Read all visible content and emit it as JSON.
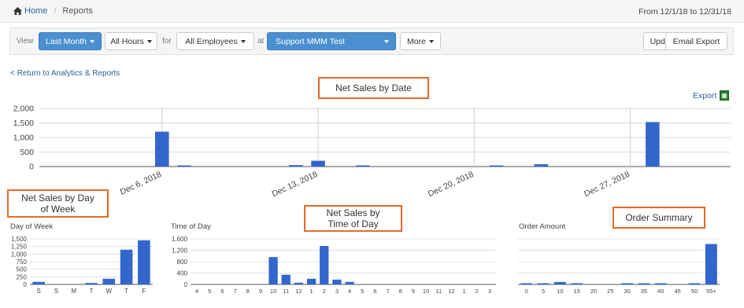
{
  "breadcrumb": {
    "home": "Home",
    "current": "Reports"
  },
  "date_range": "From 12/1/18 to 12/31/18",
  "toolbar": {
    "view_label": "View",
    "period": "Last Month",
    "hours": "All Hours",
    "for_label": "for",
    "employees": "All Employees",
    "at_label": "at",
    "location": "Support MMM Test",
    "more": "More",
    "update": "Update",
    "email_export": "Email Export"
  },
  "links": {
    "return": "< Return to Analytics & Reports",
    "export": "Export"
  },
  "callouts": {
    "net_sales_by_date": "Net Sales by Date",
    "net_sales_by_dow": "Net Sales by Day of Week",
    "net_sales_by_tod": "Net Sales by Time of Day",
    "order_summary": "Order Summary"
  },
  "section_labels": {
    "dow": "Day of Week",
    "tod": "Time of Day",
    "order": "Order Amount"
  },
  "colors": {
    "bar": "#3366cc",
    "accent": "#4a90d0",
    "callout_border": "#e8682a",
    "link": "#2a6496"
  },
  "chart_data": [
    {
      "type": "bar",
      "title": "",
      "x": [
        "12/1",
        "12/2",
        "12/3",
        "12/4",
        "12/5",
        "12/6",
        "12/7",
        "12/8",
        "12/9",
        "12/10",
        "12/11",
        "12/12",
        "12/13",
        "12/14",
        "12/15",
        "12/16",
        "12/17",
        "12/18",
        "12/19",
        "12/20",
        "12/21",
        "12/22",
        "12/23",
        "12/24",
        "12/25",
        "12/26",
        "12/27",
        "12/28",
        "12/29",
        "12/30",
        "12/31"
      ],
      "values": [
        0,
        0,
        0,
        0,
        0,
        1200,
        20,
        0,
        0,
        0,
        0,
        50,
        200,
        0,
        5,
        0,
        0,
        0,
        0,
        0,
        20,
        0,
        80,
        0,
        0,
        0,
        0,
        1530,
        0,
        0,
        0
      ],
      "tick_labels": [
        "Dec 6, 2018",
        "Dec 13, 2018",
        "Dec 20, 2018",
        "Dec 27, 2018"
      ],
      "y_ticks": [
        "0",
        "500",
        "1,000",
        "1,500",
        "2,000"
      ],
      "ylim": [
        0,
        2000
      ],
      "grid": true
    },
    {
      "type": "bar",
      "title": "",
      "categories": [
        "S",
        "S",
        "M",
        "T",
        "W",
        "T",
        "F"
      ],
      "values": [
        90,
        0,
        0,
        50,
        200,
        1220,
        1550
      ],
      "y_ticks": [
        "0",
        "250",
        "500",
        "750",
        "1,000",
        "1,250",
        "1,500"
      ],
      "ylim": [
        0,
        1600
      ],
      "grid": true
    },
    {
      "type": "bar",
      "title": "",
      "categories": [
        "4",
        "5",
        "6",
        "7",
        "8",
        "9",
        "10",
        "11",
        "12",
        "1",
        "2",
        "3",
        "4",
        "5",
        "6",
        "7",
        "8",
        "9",
        "10",
        "11",
        "12",
        "1",
        "2",
        "3"
      ],
      "values": [
        0,
        0,
        0,
        0,
        0,
        0,
        960,
        340,
        60,
        200,
        1350,
        170,
        90,
        0,
        0,
        0,
        0,
        0,
        0,
        0,
        0,
        0,
        0,
        0
      ],
      "y_ticks": [
        "0",
        "400",
        "800",
        "1,200",
        "1,600"
      ],
      "ylim": [
        0,
        1600
      ],
      "grid": true
    },
    {
      "type": "bar",
      "title": "",
      "categories": [
        "0",
        "5",
        "10",
        "15",
        "20",
        "25",
        "30",
        "35",
        "40",
        "45",
        "50",
        "55+"
      ],
      "values": [
        20,
        10,
        80,
        10,
        0,
        0,
        40,
        20,
        20,
        0,
        20,
        1330
      ],
      "ylim": [
        0,
        1500
      ],
      "grid": true
    }
  ]
}
